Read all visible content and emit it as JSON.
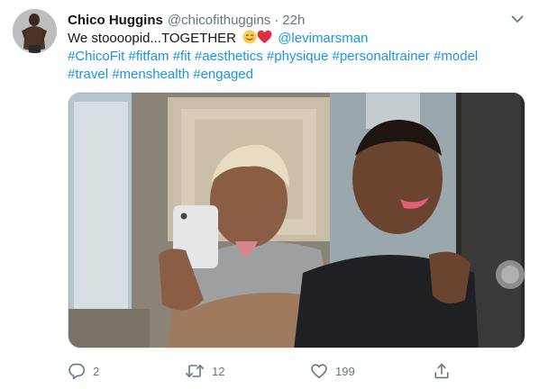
{
  "tweet": {
    "author": {
      "display_name": "Chico Huggins",
      "handle": "@chicofithuggins",
      "separator": "·",
      "time": "22h"
    },
    "text": {
      "line1_prefix": "We stoooopid...TOGETHER",
      "mention": "@levimarsman",
      "hashtags_line2": "#ChicoFit #fitfam #fit #aesthetics #physique #personaltrainer #model",
      "hashtags_line3": "#travel #menshealth #engaged"
    },
    "stats": {
      "replies": "2",
      "retweets": "12",
      "likes": "199"
    }
  },
  "colors": {
    "link": "#1b95e0",
    "muted": "#657786",
    "text": "#14171a",
    "heart_emoji": "#e0245e"
  },
  "icons": [
    "avatar",
    "chevron-down-icon",
    "smiling-face-emoji",
    "red-heart-emoji",
    "reply-icon",
    "retweet-icon",
    "like-icon",
    "share-icon"
  ]
}
